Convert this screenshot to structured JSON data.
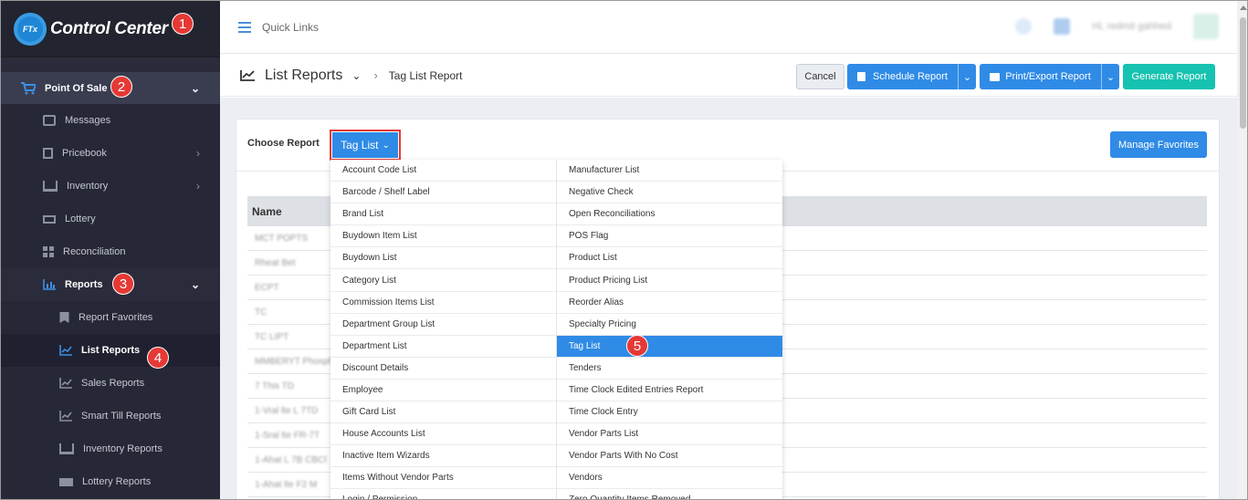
{
  "app": {
    "logo_text": "Control Center",
    "logo_badge": "FTx"
  },
  "callouts": [
    "1",
    "2",
    "3",
    "4",
    "5"
  ],
  "sidebar": {
    "point_of_sale": "Point Of Sale",
    "items": [
      {
        "label": "Messages",
        "icon": "messages-icon"
      },
      {
        "label": "Pricebook",
        "icon": "calculator-icon",
        "has_children": true
      },
      {
        "label": "Inventory",
        "icon": "inventory-icon",
        "has_children": true
      },
      {
        "label": "Lottery",
        "icon": "lottery-icon"
      },
      {
        "label": "Reconciliation",
        "icon": "grid-icon"
      },
      {
        "label": "Reports",
        "icon": "bar-chart-icon"
      }
    ],
    "report_items": [
      {
        "label": "Report Favorites",
        "icon": "bookmark-icon"
      },
      {
        "label": "List Reports",
        "icon": "line-chart-icon"
      },
      {
        "label": "Sales Reports",
        "icon": "line-chart-icon"
      },
      {
        "label": "Smart Till Reports",
        "icon": "line-chart-icon"
      },
      {
        "label": "Inventory Reports",
        "icon": "inventory-icon"
      },
      {
        "label": "Lottery Reports",
        "icon": "ticket-icon"
      }
    ]
  },
  "topbar": {
    "quick_links": "Quick Links",
    "user_text": "Hi, redmit gahhed"
  },
  "header": {
    "title": "List Reports",
    "breadcrumb": "Tag List Report",
    "cancel": "Cancel",
    "schedule": "Schedule Report",
    "print_export": "Print/Export Report",
    "generate": "Generate Report"
  },
  "card": {
    "choose_label": "Choose Report",
    "selected_report": "Tag List",
    "manage_favorites": "Manage Favorites",
    "column_name": "Name",
    "rows": [
      "MCT POPTS",
      "Rheat Bet",
      "ECPT",
      "TC",
      "TC LIPT",
      "MMBERYT Phosph",
      "7 This TD",
      "1-Vral lte L 7TD",
      "1-Sral lte FR-7T",
      "1-Ahat L 7B CBCl",
      "1-Ahat lte F2 M"
    ]
  },
  "dropdown": {
    "left": [
      "Account Code List",
      "Barcode / Shelf Label",
      "Brand List",
      "Buydown Item List",
      "Buydown List",
      "Category List",
      "Commission Items List",
      "Department Group List",
      "Department List",
      "Discount Details",
      "Employee",
      "Gift Card List",
      "House Accounts List",
      "Inactive Item Wizards",
      "Items Without Vendor Parts",
      "Login / Permission"
    ],
    "right": [
      "Manufacturer List",
      "Negative Check",
      "Open Reconciliations",
      "POS Flag",
      "Product List",
      "Product Pricing List",
      "Reorder Alias",
      "Specialty Pricing",
      "Tag List",
      "Tenders",
      "Time Clock Edited Entries Report",
      "Time Clock Entry",
      "Vendor Parts List",
      "Vendor Parts With No Cost",
      "Vendors",
      "Zero Quantity Items Removed"
    ],
    "selected": "Tag List"
  }
}
